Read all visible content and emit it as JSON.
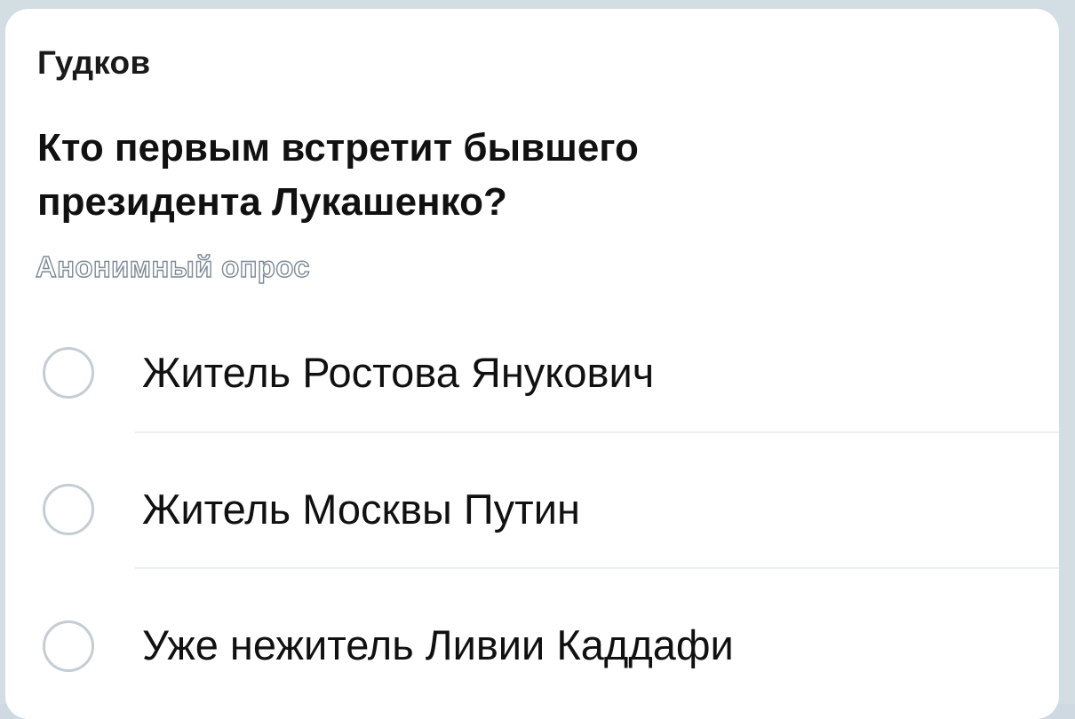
{
  "message": {
    "sender": "Гудков"
  },
  "poll": {
    "question_line1": "Кто первым встретит бывшего",
    "question_line2": "президента Лукашенко?",
    "type_label": "Анонимный опрос",
    "options": [
      {
        "label": "Житель Ростова Янукович"
      },
      {
        "label": "Житель Москвы Путин"
      },
      {
        "label": "Уже нежитель Ливии Каддафи"
      }
    ]
  },
  "colors": {
    "bubble": "#ffffff",
    "radio_border": "#c4cdd4",
    "divider": "#edf1f4",
    "muted_text": "#7d8a95"
  },
  "icons": {
    "radio": "radio-unchecked-icon"
  }
}
